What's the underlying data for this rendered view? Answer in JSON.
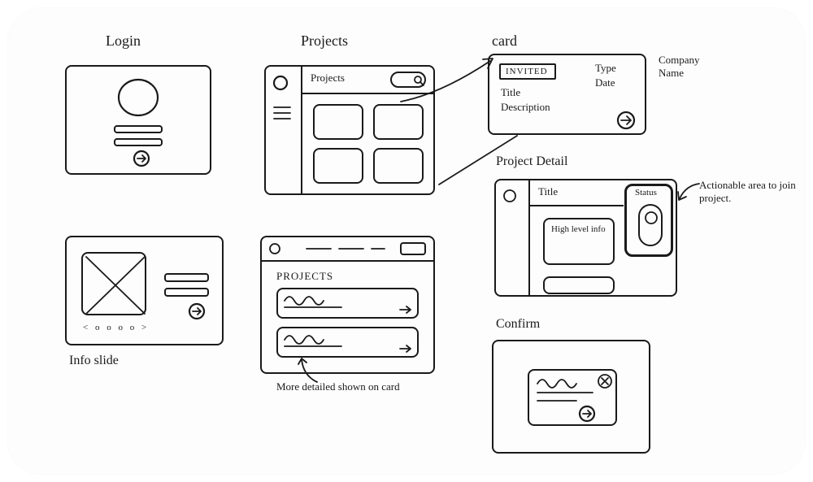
{
  "labels": {
    "login": "Login",
    "projects": "Projects",
    "projects_header": "Projects",
    "projects_header2": "PROJECTS",
    "info_slide": "Info slide",
    "more_detailed": "More detailed shown on card",
    "card": "card",
    "invited": "INVITED",
    "type": "Type",
    "date": "Date",
    "title": "Title",
    "description": "Description",
    "company_name": "Company Name",
    "project_detail": "Project Detail",
    "project_title": "Title",
    "status": "Status",
    "high_level": "High level info",
    "actionable": "Actionable area to join project.",
    "confirm": "Confirm"
  },
  "pager": "< o o o o >"
}
